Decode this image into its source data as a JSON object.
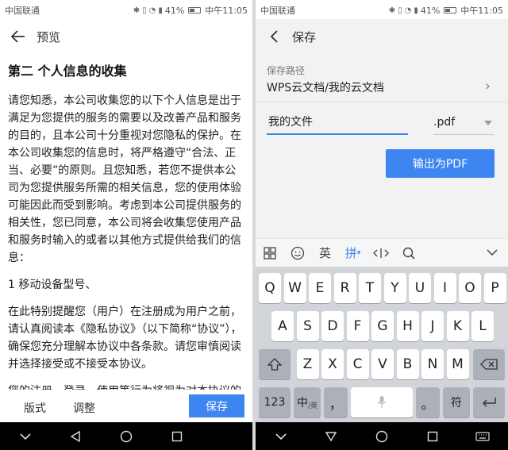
{
  "left": {
    "status": {
      "carrier": "中国联通",
      "battery": "41%",
      "time": "中午11:05"
    },
    "appbar": {
      "back_icon": "back-arrow-icon",
      "title": "预览"
    },
    "doc": {
      "heading": "第二 个人信息的收集",
      "para1": "请您知悉，本公司收集您的以下个人信息是出于满足为您提供的服务的需要以及改善产品和服务的目的，且本公司十分重视对您隐私的保护。在本公司收集您的信息时，将严格遵守“合法、正当、必要”的原则。且您知悉，若您不提供本公司为您提供服务所需的相关信息，您的使用体验可能因此而受到影响。考虑到本公司提供服务的相关性，您已同意，本公司将会收集您使用产品和服务时输入的或者以其他方式提供给我们的信息：",
      "para2": "1 移动设备型号、",
      "para3": "在此特别提醒您（用户）在注册成为用户之前，请认真阅读本《隐私协议》（以下简称“协议”），确保您充分理解本协议中各条款。请您审慎阅读并选择接受或不接受本协议。",
      "para4": "您的注册、登录、使用等行为将视为对本协议的"
    },
    "bottom": {
      "layout_label": "版式",
      "adjust_label": "调整",
      "save_label": "保存"
    },
    "nav": {
      "back": "nav-back-icon",
      "home": "nav-home-icon",
      "recent": "nav-recent-icon",
      "down": "nav-down-icon"
    }
  },
  "right": {
    "status": {
      "carrier": "中国联通",
      "battery": "41%",
      "time": "中午11:05"
    },
    "appbar": {
      "back_icon": "back-chevron-icon",
      "title": "保存"
    },
    "save": {
      "path_label": "保存路径",
      "path_value": "WPS云文档/我的云文档",
      "filename": "我的文件",
      "extension": ".pdf",
      "export_label": "输出为PDF"
    },
    "keyboard": {
      "toolbar": {
        "lang": "英",
        "pinyin": "拼"
      },
      "row1": [
        "Q",
        "W",
        "E",
        "R",
        "T",
        "Y",
        "U",
        "I",
        "O",
        "P"
      ],
      "row2": [
        "A",
        "S",
        "D",
        "F",
        "G",
        "H",
        "J",
        "K",
        "L"
      ],
      "row3": [
        "Z",
        "X",
        "C",
        "V",
        "B",
        "N",
        "M"
      ],
      "num_label": "123",
      "zh_label": "中",
      "zh_sub": "/英",
      "comma": "，",
      "period": "。",
      "symbol_label": "符"
    }
  },
  "colors": {
    "accent": "#3d85f0",
    "keyboard_bg": "#d1d4d9"
  }
}
